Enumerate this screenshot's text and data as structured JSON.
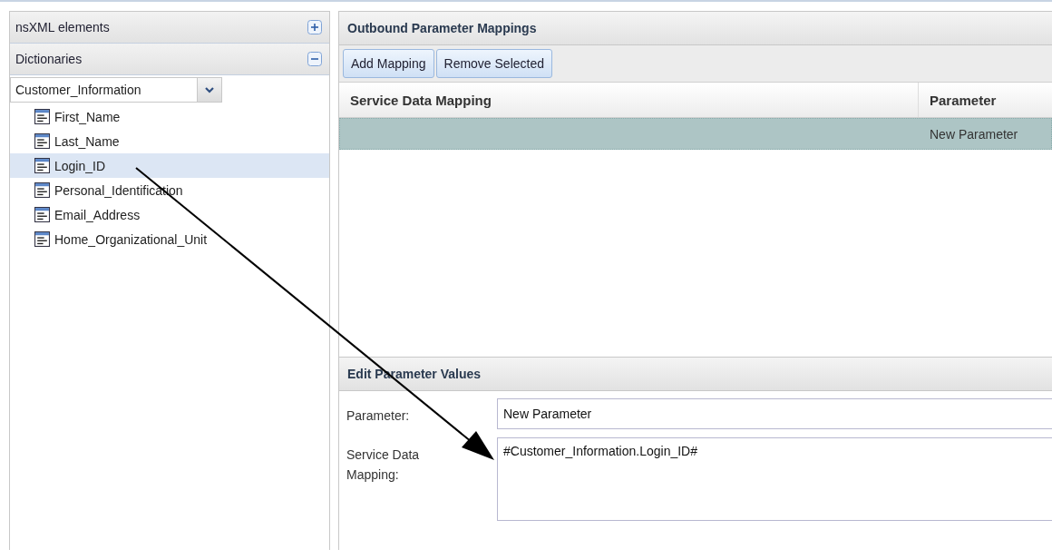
{
  "sidebar": {
    "sections": [
      {
        "title": "nsXML elements",
        "expanded": false
      },
      {
        "title": "Dictionaries",
        "expanded": true
      }
    ],
    "dictionary_select": {
      "value": "Customer_Information"
    },
    "items": [
      {
        "label": "First_Name",
        "selected": false
      },
      {
        "label": "Last_Name",
        "selected": false
      },
      {
        "label": "Login_ID",
        "selected": true
      },
      {
        "label": "Personal_Identification",
        "selected": false
      },
      {
        "label": "Email_Address",
        "selected": false
      },
      {
        "label": "Home_Organizational_Unit",
        "selected": false
      }
    ]
  },
  "mappings": {
    "title": "Outbound Parameter Mappings",
    "buttons": [
      "Add Mapping",
      "Remove Selected"
    ],
    "columns": [
      "Service Data Mapping",
      "Parameter"
    ],
    "rows": [
      {
        "cells": [
          "",
          "New Parameter"
        ],
        "selected": true
      }
    ]
  },
  "edit": {
    "title": "Edit Parameter Values",
    "fields": [
      {
        "kind": "input",
        "label": "Parameter:",
        "value": "New Parameter"
      },
      {
        "kind": "textarea",
        "label": "Service Data Mapping:",
        "value": "#Customer_Information.Login_ID#"
      }
    ]
  }
}
